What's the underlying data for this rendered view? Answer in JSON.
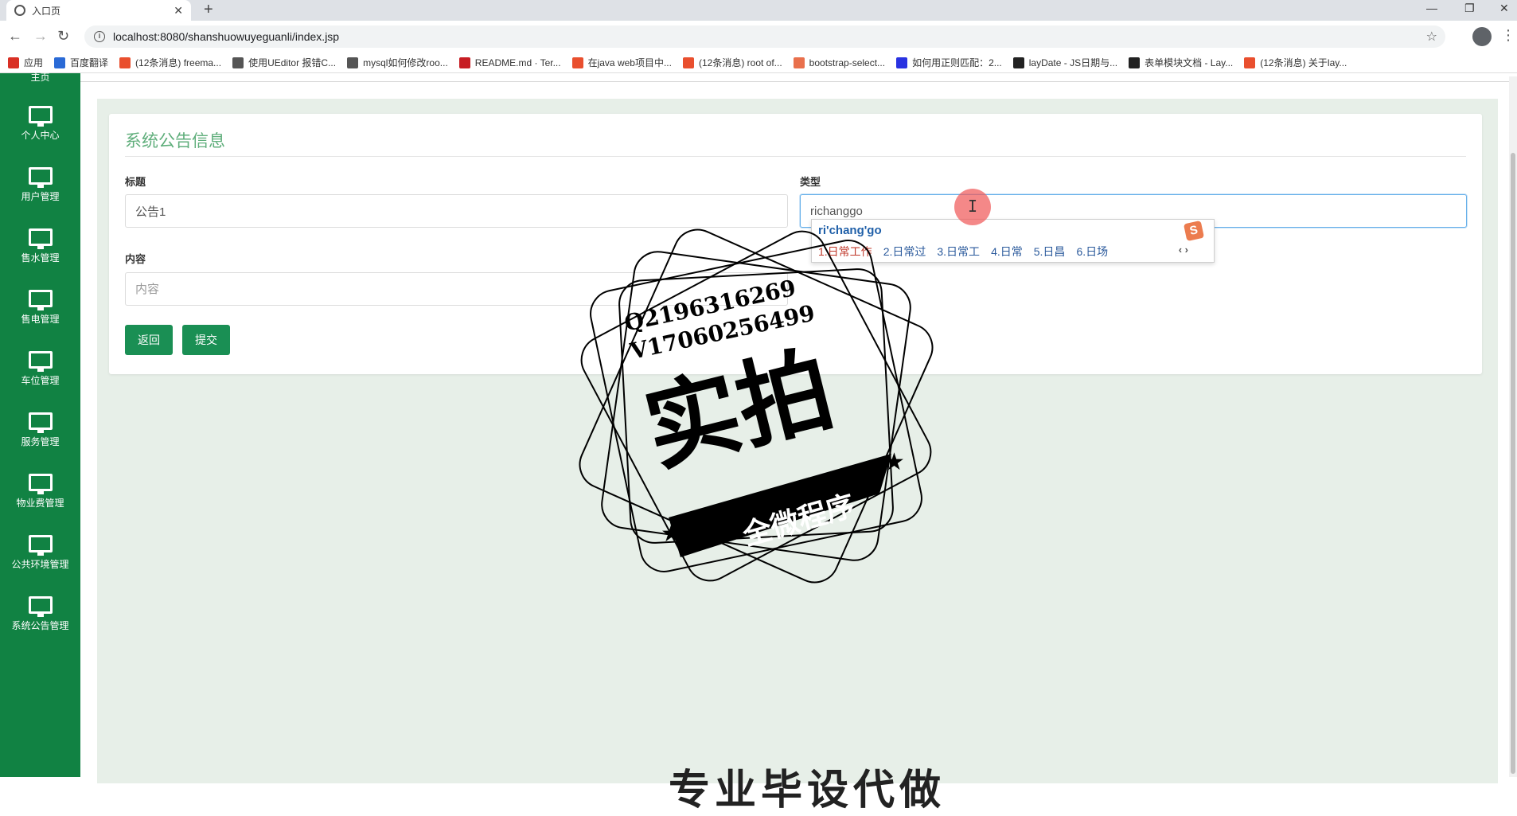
{
  "browser": {
    "tab_title": "入口页",
    "tab_close": "✕",
    "new_tab": "+",
    "url": "localhost:8080/shanshuowuyeguanli/index.jsp",
    "window_controls": [
      "—",
      "❐",
      "✕"
    ],
    "bookmarks": [
      {
        "label": "应用",
        "icon": "apps-icon",
        "color": "#d93025"
      },
      {
        "label": "百度翻译",
        "icon": "translate-icon",
        "color": "#2a6ad6"
      },
      {
        "label": "(12条消息) freema...",
        "icon": "csdn-icon",
        "color": "#e94f2e"
      },
      {
        "label": "使用UEditor 报错C...",
        "icon": "bird-icon",
        "color": "#555555"
      },
      {
        "label": "mysql如何修改roo...",
        "icon": "bird-icon",
        "color": "#555555"
      },
      {
        "label": "README.md · Ter...",
        "icon": "gitee-icon",
        "color": "#c71d23"
      },
      {
        "label": "在java web项目中...",
        "icon": "csdn-icon",
        "color": "#e94f2e"
      },
      {
        "label": "(12条消息) root of...",
        "icon": "csdn-icon",
        "color": "#e94f2e"
      },
      {
        "label": "bootstrap-select...",
        "icon": "jianshu-icon",
        "color": "#e9704c"
      },
      {
        "label": "如何用正则匹配：2...",
        "icon": "baidu-paw-icon",
        "color": "#2932e1"
      },
      {
        "label": "layDate - JS日期与...",
        "icon": "layui-icon",
        "color": "#222222"
      },
      {
        "label": "表单模块文档 - Lay...",
        "icon": "layui-icon",
        "color": "#222222"
      },
      {
        "label": "(12条消息) 关于lay...",
        "icon": "csdn-icon",
        "color": "#e94f2e"
      }
    ]
  },
  "sidebar": {
    "partial_label": "主页",
    "items": [
      {
        "label": "个人中心"
      },
      {
        "label": "用户管理"
      },
      {
        "label": "售水管理"
      },
      {
        "label": "售电管理"
      },
      {
        "label": "车位管理"
      },
      {
        "label": "服务管理"
      },
      {
        "label": "物业费管理"
      },
      {
        "label": "公共环境管理"
      },
      {
        "label": "系统公告管理"
      }
    ]
  },
  "form": {
    "title": "系统公告信息",
    "title_label": "标题",
    "title_value": "公告1",
    "type_label": "类型",
    "type_value": "richanggo",
    "content_label": "内容",
    "content_placeholder": "内容",
    "back_button": "返回",
    "submit_button": "提交"
  },
  "ime": {
    "composition": "ri'chang'go",
    "candidates": [
      "1.日常工作",
      "2.日常过",
      "3.日常工",
      "4.日常",
      "5.日昌",
      "6.日场"
    ],
    "logo": "S",
    "arrows": "‹ ›"
  },
  "watermark": {
    "line1": "Q2196316269",
    "line2": "V17060256499",
    "big": "实拍",
    "banner": "全微程序",
    "bottom": "专业毕设代做"
  },
  "colors": {
    "sidebar": "#118243",
    "button": "#1a8f54",
    "title": "#5fae7b",
    "page_bg": "#e7efe8"
  }
}
